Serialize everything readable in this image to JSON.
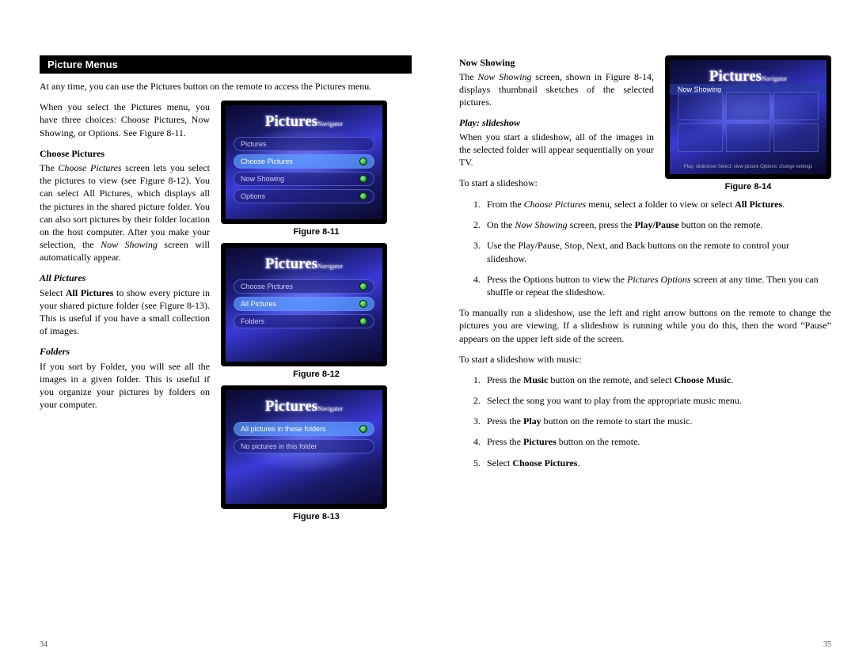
{
  "left": {
    "bar_title": "Picture Menus",
    "intro": "At any time, you can use the Pictures button on the remote to access the Pictures menu.",
    "menu_intro": "When you select the Pictures menu, you have three choices: Choose Pictures, Now Showing, or Options. See Figure 8-11.",
    "choose_h": "Choose Pictures",
    "choose_p": "The Choose Pictures screen lets you select the pictures to view (see Figure 8-12). You can select All Pictures, which displays all the pictures in the shared picture folder. You can also sort pictures by their folder location on the host computer. After you make your selection, the Now Showing screen will automatically appear.",
    "all_h": "All Pictures",
    "all_p": "Select All Pictures to show every picture in your shared picture folder (see Figure 8-13). This is useful if you have a small collection of images.",
    "folders_h": "Folders",
    "folders_p": "If you sort by Folder, you will see all the images in a given folder. This is useful if you organize your pictures by folders on your computer.",
    "fig11": "Figure 8-11",
    "fig12": "Figure 8-12",
    "fig13": "Figure 8-13",
    "fig_brand": "Pictures",
    "fig_brand_sub": "Navigator",
    "f11_items": [
      "Pictures",
      "Choose Pictures",
      "Now Showing",
      "Options"
    ],
    "f12_items": [
      "Choose Pictures",
      "All Pictures",
      "Folders"
    ],
    "f13_items": [
      "All pictures in these folders",
      "No pictures in this folder"
    ],
    "page_num": "34"
  },
  "right": {
    "now_h": "Now Showing",
    "now_p": "The Now Showing screen, shown in Figure 8-14, displays thumbnail sketches of the selected pictures.",
    "play_h": "Play: slideshow",
    "play_p": "When you start a slideshow, all of the images in the selected folder will appear sequentially on your TV.",
    "start_p": "To start a slideshow:",
    "fig14": "Figure 8-14",
    "f14_sub": "Now Showing",
    "f14_footer": "Play: slideshow Select: view picture Options: change settings",
    "steps1": [
      "From the Choose Pictures menu, select a folder to view or select All Pictures.",
      "On the Now Showing screen, press the Play/Pause button on the remote.",
      "Use the Play/Pause, Stop, Next, and Back buttons on the remote to control your slideshow.",
      "Press the Options button to view the Pictures Options screen at any time. Then you can shuffle or repeat the slideshow."
    ],
    "manual_p": "To manually run a slideshow, use the left and right arrow buttons on the remote to change the pictures you are viewing. If a slideshow is running while you do this, then the word “Pause” appears on the upper left side of the screen.",
    "music_intro": "To start a slideshow with music:",
    "steps2": [
      "Press the Music button on the remote, and select Choose Music.",
      "Select the song you want to play from the appropriate music menu.",
      "Press the Play button on the remote to start the music.",
      "Press the Pictures button on the remote.",
      "Select Choose Pictures."
    ],
    "page_num": "35"
  }
}
